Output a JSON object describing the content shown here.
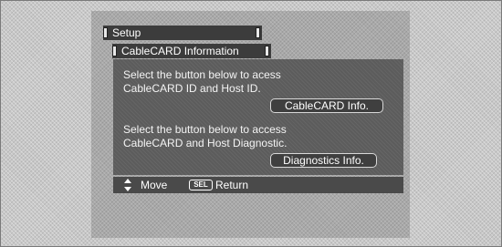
{
  "menu": {
    "title": "Setup",
    "subtitle": "CableCARD Information"
  },
  "content": {
    "cablecard_line1": "Select the button below to acess",
    "cablecard_line2": "CableCARD ID and Host ID.",
    "cablecard_button": "CableCARD Info.",
    "diag_line1": "Select the button below to access",
    "diag_line2": "CableCARD and Host Diagnostic.",
    "diag_button": "Diagnostics Info."
  },
  "footer": {
    "move_icon": "up-down-arrow-icon",
    "move_label": "Move",
    "sel_key": "SEL",
    "return_label": "Return"
  }
}
